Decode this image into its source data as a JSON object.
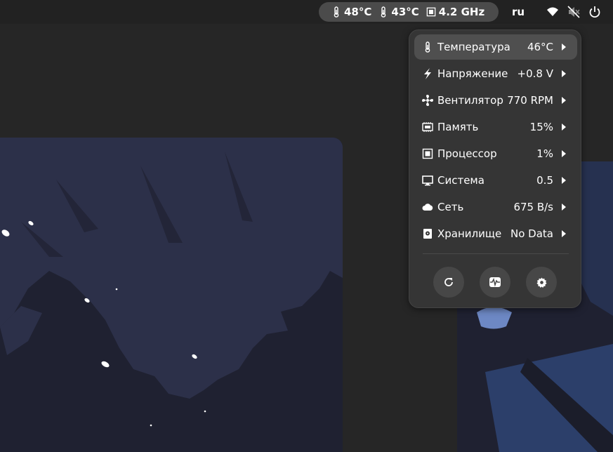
{
  "topbar": {
    "sensors": [
      {
        "icon": "thermometer-icon",
        "value": "48°C"
      },
      {
        "icon": "thermometer-icon",
        "value": "43°C"
      },
      {
        "icon": "cpu-icon",
        "value": "4.2 GHz"
      }
    ],
    "language": "ru",
    "system_icons": [
      "wifi-icon",
      "muted-speaker-icon",
      "power-icon"
    ]
  },
  "menu": {
    "items": [
      {
        "icon": "thermometer-icon",
        "label": "Температура",
        "value": "46°C",
        "active": true
      },
      {
        "icon": "lightning-icon",
        "label": "Напряжение",
        "value": "+0.8 V",
        "active": false
      },
      {
        "icon": "fan-icon",
        "label": "Вентилятор",
        "value": "770 RPM",
        "active": false
      },
      {
        "icon": "memory-icon",
        "label": "Память",
        "value": "15%",
        "active": false
      },
      {
        "icon": "cpu-icon",
        "label": "Процессор",
        "value": "1%",
        "active": false
      },
      {
        "icon": "monitor-icon",
        "label": "Система",
        "value": "0.5",
        "active": false
      },
      {
        "icon": "cloud-icon",
        "label": "Сеть",
        "value": "675 B/s",
        "active": false
      },
      {
        "icon": "storage-icon",
        "label": "Хранилище",
        "value": "No Data",
        "active": false
      }
    ],
    "buttons": [
      "refresh-icon",
      "system-monitor-icon",
      "settings-icon"
    ]
  }
}
